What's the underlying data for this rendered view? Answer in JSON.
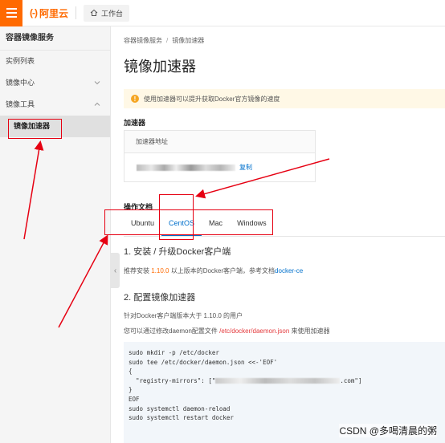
{
  "topbar": {
    "logo_mark": "(-)",
    "logo_text": "阿里云",
    "workbench": "工作台"
  },
  "sidebar": {
    "title": "容器镜像服务",
    "items": [
      {
        "label": "实例列表"
      },
      {
        "label": "镜像中心"
      },
      {
        "label": "镜像工具"
      }
    ],
    "active_sub": "镜像加速器"
  },
  "main": {
    "breadcrumb": [
      "容器镜像服务",
      "镜像加速器"
    ],
    "breadcrumb_sep": "/",
    "title": "镜像加速器",
    "notice": "使用加速器可以提升获取Docker官方镜像的速度",
    "accelerator_label": "加速器",
    "accelerator_table_header": "加速器地址",
    "copy_label": "复制",
    "ops_label": "操作文档",
    "tabs": [
      "Ubuntu",
      "CentOS",
      "Mac",
      "Windows"
    ],
    "active_tab": "CentOS",
    "install_heading": "1. 安装 / 升级Docker客户端",
    "install_text_pre": "推荐安装 ",
    "install_version": "1.10.0",
    "install_text_mid": " 以上版本的Docker客户端，参考文档",
    "install_link": "docker-ce",
    "config_heading": "2. 配置镜像加速器",
    "config_text1": "针对Docker客户端版本大于 1.10.0 的用户",
    "config_text2_pre": "您可以通过修改daemon配置文件 ",
    "config_path": "/etc/docker/daemon.json",
    "config_text2_post": " 来使用加速器",
    "code_lines": [
      "sudo mkdir -p /etc/docker",
      "sudo tee /etc/docker/daemon.json <<-'EOF'",
      "{",
      "  \"registry-mirrors\": [\"",
      "}",
      "EOF",
      "sudo systemctl daemon-reload",
      "sudo systemctl restart docker"
    ],
    "code_line4_tail": ".com\"]"
  },
  "watermark": "CSDN @多喝清晨的粥",
  "colors": {
    "brand": "#ff6a00",
    "link": "#0070cc",
    "annotation": "#e60012"
  }
}
